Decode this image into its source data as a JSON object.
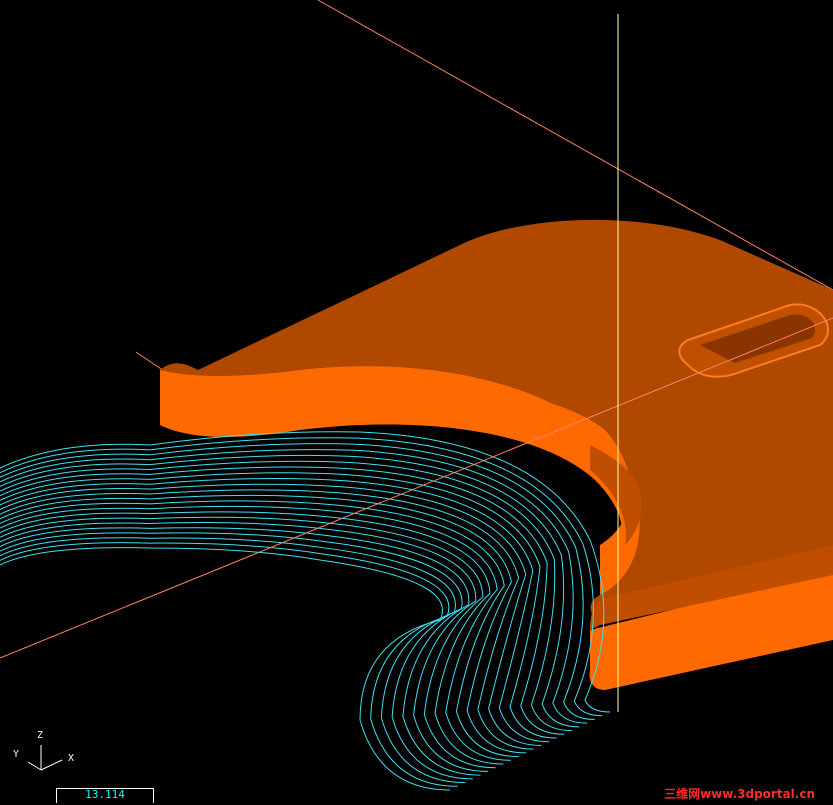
{
  "viewport": {
    "background": "#000000",
    "part_color": "#ff6a00",
    "part_shadow_color": "#a84400",
    "toolpath_color": "#40e0f0",
    "guide_line_color": "#ff8060",
    "vertical_guide_color": "#ffffa0"
  },
  "axis_triad": {
    "z_label": "Z",
    "y_label": "Y",
    "x_label": "X"
  },
  "scale_bar": {
    "value": "13.114"
  },
  "watermark": {
    "text": "三维网www.3dportal.cn"
  }
}
